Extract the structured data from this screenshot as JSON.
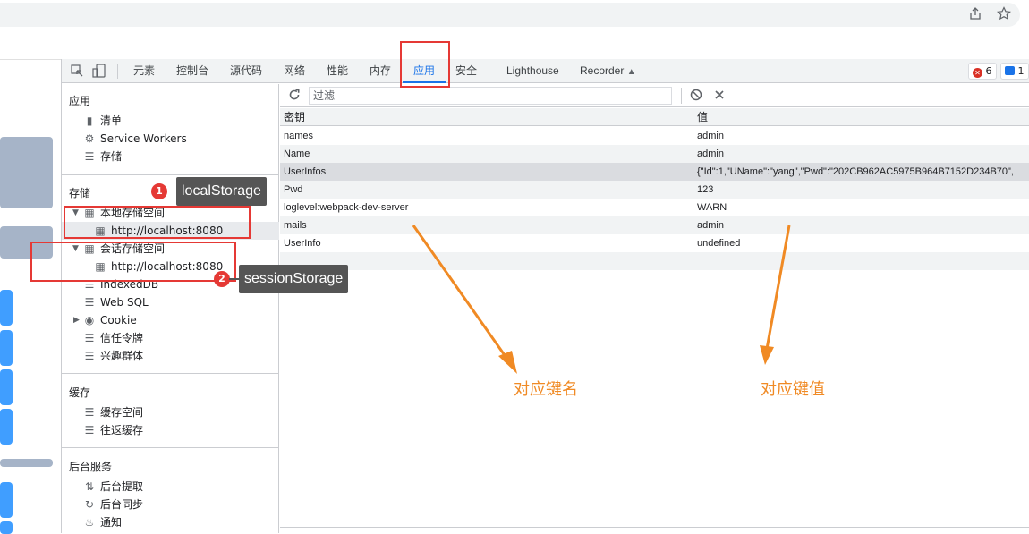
{
  "browser": {
    "share_icon": "share-icon",
    "bookmark_icon": "star-icon"
  },
  "devtools": {
    "tabs": [
      "元素",
      "控制台",
      "源代码",
      "网络",
      "性能",
      "内存",
      "应用",
      "安全",
      "Lighthouse",
      "Recorder"
    ],
    "active_tab": "应用",
    "error_count": "6",
    "message_count": "1"
  },
  "sidebar": {
    "app_title": "应用",
    "app_items": [
      "清单",
      "Service Workers",
      "存储"
    ],
    "storage_title": "存储",
    "local_storage": "本地存储空间",
    "local_origin": "http://localhost:8080",
    "session_storage": "会话存储空间",
    "session_origin": "http://localhost:8080",
    "storage_items": [
      "IndexedDB",
      "Web SQL",
      "Cookie",
      "信任令牌",
      "兴趣群体"
    ],
    "cache_title": "缓存",
    "cache_items": [
      "缓存空间",
      "往返缓存"
    ],
    "bg_title": "后台服务",
    "bg_items": [
      "后台提取",
      "后台同步",
      "通知"
    ]
  },
  "main": {
    "filter_placeholder": "过滤",
    "col_key": "密钥",
    "col_value": "值",
    "rows": [
      {
        "key": "names",
        "value": "admin"
      },
      {
        "key": "Name",
        "value": "admin"
      },
      {
        "key": "UserInfos",
        "value": "{\"Id\":1,\"UName\":\"yang\",\"Pwd\":\"202CB962AC5975B964B7152D234B70\","
      },
      {
        "key": "Pwd",
        "value": "123"
      },
      {
        "key": "loglevel:webpack-dev-server",
        "value": "WARN"
      },
      {
        "key": "mails",
        "value": "admin"
      },
      {
        "key": "UserInfo",
        "value": "undefined"
      }
    ]
  },
  "annotations": {
    "callout1_num": "1",
    "callout1_text": "localStorage",
    "callout2_num": "2",
    "callout2_text": "sessionStorage",
    "key_label": "对应键名",
    "value_label": "对应键值",
    "accent_color": "#f08a24",
    "box_color": "#e53935"
  }
}
